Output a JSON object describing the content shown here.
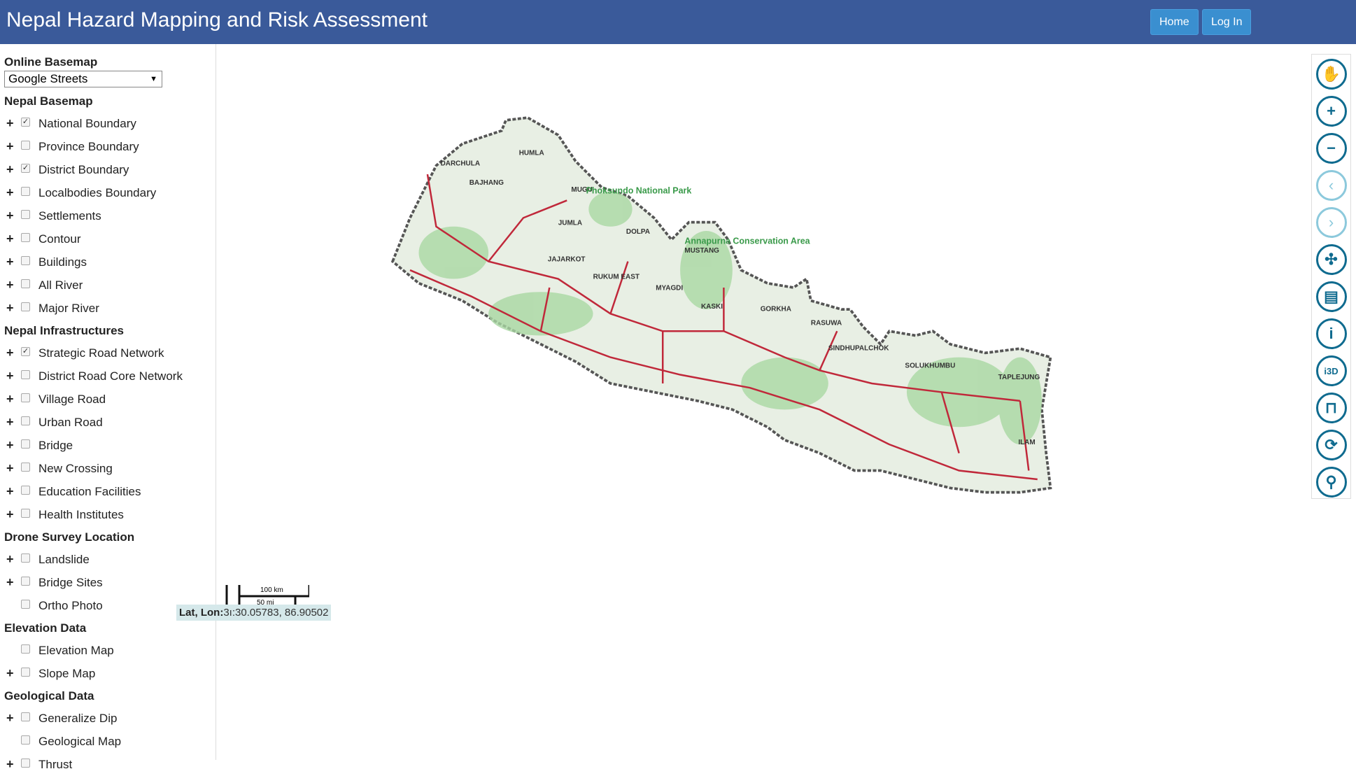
{
  "header": {
    "title": "Nepal Hazard Mapping and Risk Assessment",
    "home": "Home",
    "login": "Log In"
  },
  "sidebar": {
    "basemap_label": "Online Basemap",
    "basemap_value": "Google Streets",
    "sections": [
      {
        "title": "Nepal Basemap",
        "items": [
          {
            "label": "National Boundary",
            "checked": true,
            "expand": true
          },
          {
            "label": "Province Boundary",
            "checked": false,
            "expand": true
          },
          {
            "label": "District Boundary",
            "checked": true,
            "expand": true
          },
          {
            "label": "Localbodies Boundary",
            "checked": false,
            "expand": true
          },
          {
            "label": "Settlements",
            "checked": false,
            "expand": true
          },
          {
            "label": "Contour",
            "checked": false,
            "expand": true
          },
          {
            "label": "Buildings",
            "checked": false,
            "expand": true
          },
          {
            "label": "All River",
            "checked": false,
            "expand": true
          },
          {
            "label": "Major River",
            "checked": false,
            "expand": true
          }
        ]
      },
      {
        "title": "Nepal Infrastructures",
        "items": [
          {
            "label": "Strategic Road Network",
            "checked": true,
            "expand": true
          },
          {
            "label": "District Road Core Network",
            "checked": false,
            "expand": true
          },
          {
            "label": "Village Road",
            "checked": false,
            "expand": true
          },
          {
            "label": "Urban Road",
            "checked": false,
            "expand": true
          },
          {
            "label": "Bridge",
            "checked": false,
            "expand": true
          },
          {
            "label": "New Crossing",
            "checked": false,
            "expand": true
          },
          {
            "label": "Education Facilities",
            "checked": false,
            "expand": true
          },
          {
            "label": "Health Institutes",
            "checked": false,
            "expand": true
          }
        ]
      },
      {
        "title": "Drone Survey Location",
        "items": [
          {
            "label": "Landslide",
            "checked": false,
            "expand": true
          },
          {
            "label": "Bridge Sites",
            "checked": false,
            "expand": true
          },
          {
            "label": "Ortho Photo",
            "checked": false,
            "expand": false
          }
        ]
      },
      {
        "title": "Elevation Data",
        "items": [
          {
            "label": "Elevation Map",
            "checked": false,
            "expand": false
          },
          {
            "label": "Slope Map",
            "checked": false,
            "expand": true
          }
        ]
      },
      {
        "title": "Geological Data",
        "items": [
          {
            "label": "Generalize Dip",
            "checked": false,
            "expand": true
          },
          {
            "label": "Geological Map",
            "checked": false,
            "expand": false
          },
          {
            "label": "Thrust",
            "checked": false,
            "expand": true
          }
        ]
      }
    ]
  },
  "toolbar": [
    {
      "name": "pan-hand-icon",
      "glyph": "✋"
    },
    {
      "name": "zoom-in-icon",
      "glyph": "+"
    },
    {
      "name": "zoom-out-icon",
      "glyph": "−"
    },
    {
      "name": "previous-extent-icon",
      "glyph": "‹",
      "light": true
    },
    {
      "name": "next-extent-icon",
      "glyph": "›",
      "light": true
    },
    {
      "name": "full-extent-icon",
      "glyph": "✣"
    },
    {
      "name": "print-icon",
      "glyph": "▤"
    },
    {
      "name": "info-icon",
      "glyph": "i"
    },
    {
      "name": "info-3d-icon",
      "glyph": "i3D"
    },
    {
      "name": "bridge-icon",
      "glyph": "⊓"
    },
    {
      "name": "search-refresh-icon",
      "glyph": "⟳"
    },
    {
      "name": "route-icon",
      "glyph": "⚲"
    }
  ],
  "map": {
    "scale_km": "100 km",
    "scale_mi": "50 mi",
    "latlon_label": "Lat, Lon:",
    "latlon_value": "3ı:30.05783, 86.90502",
    "labels": [
      "HUMLA",
      "BAJHANG",
      "DARCHULA",
      "MUGU",
      "JUMLA",
      "DOLPA",
      "JAJARKOT",
      "RUKUM EAST",
      "MUSTANG",
      "MYAGDI",
      "KASKI",
      "GORKHA",
      "RASUWA",
      "SINDHUPALCHOK",
      "SOLUKHUMBU",
      "TAPLEJUNG",
      "ILAM",
      "Phoksundo National Park",
      "Annapurna Conservation Area"
    ],
    "colors": {
      "header": "#3a5a9a",
      "road": "#c0283a",
      "land": "#dfeedd",
      "green": "#9fd49a",
      "border": "#555555"
    }
  }
}
